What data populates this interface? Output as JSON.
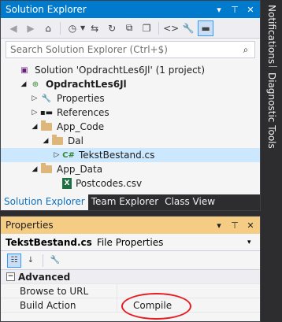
{
  "solution_explorer": {
    "title": "Solution Explorer",
    "pin_glyph": "⊤",
    "close_glyph": "✕",
    "dropdown_glyph": "▾",
    "search_placeholder": "Search Solution Explorer (Ctrl+$)",
    "tree": [
      {
        "label": "Solution 'OpdrachtLes6Jl' (1 project)",
        "icon": "solution-icon"
      },
      {
        "label": "OpdrachtLes6Jl",
        "icon": "web-project-icon",
        "expanded": true,
        "bold": true
      },
      {
        "label": "Properties",
        "icon": "wrench-icon"
      },
      {
        "label": "References",
        "icon": "references-icon"
      },
      {
        "label": "App_Code",
        "icon": "folder-open-icon",
        "expanded": true
      },
      {
        "label": "Dal",
        "icon": "folder-open-icon",
        "expanded": true
      },
      {
        "label": "TekstBestand.cs",
        "icon": "csharp-file-icon",
        "selected": true
      },
      {
        "label": "App_Data",
        "icon": "folder-open-icon",
        "expanded": true
      },
      {
        "label": "Postcodes.csv",
        "icon": "excel-file-icon"
      }
    ],
    "tabs": [
      "Solution Explorer",
      "Team Explorer",
      "Class View"
    ]
  },
  "properties": {
    "title": "Properties",
    "pin_glyph": "⊤",
    "close_glyph": "✕",
    "dropdown_glyph": "▾",
    "object_name": "TekstBestand.cs",
    "object_type": "File Properties",
    "category": "Advanced",
    "category_glyph": "−",
    "rows": [
      {
        "name": "Browse to URL",
        "value": ""
      },
      {
        "name": "Build Action",
        "value": "Compile"
      }
    ]
  },
  "side_tabs": [
    "Notifications",
    "Diagnostic Tools"
  ],
  "colors": {
    "accent": "#007acc",
    "properties_title": "#f5cc84",
    "annotation": "#e51d23"
  }
}
